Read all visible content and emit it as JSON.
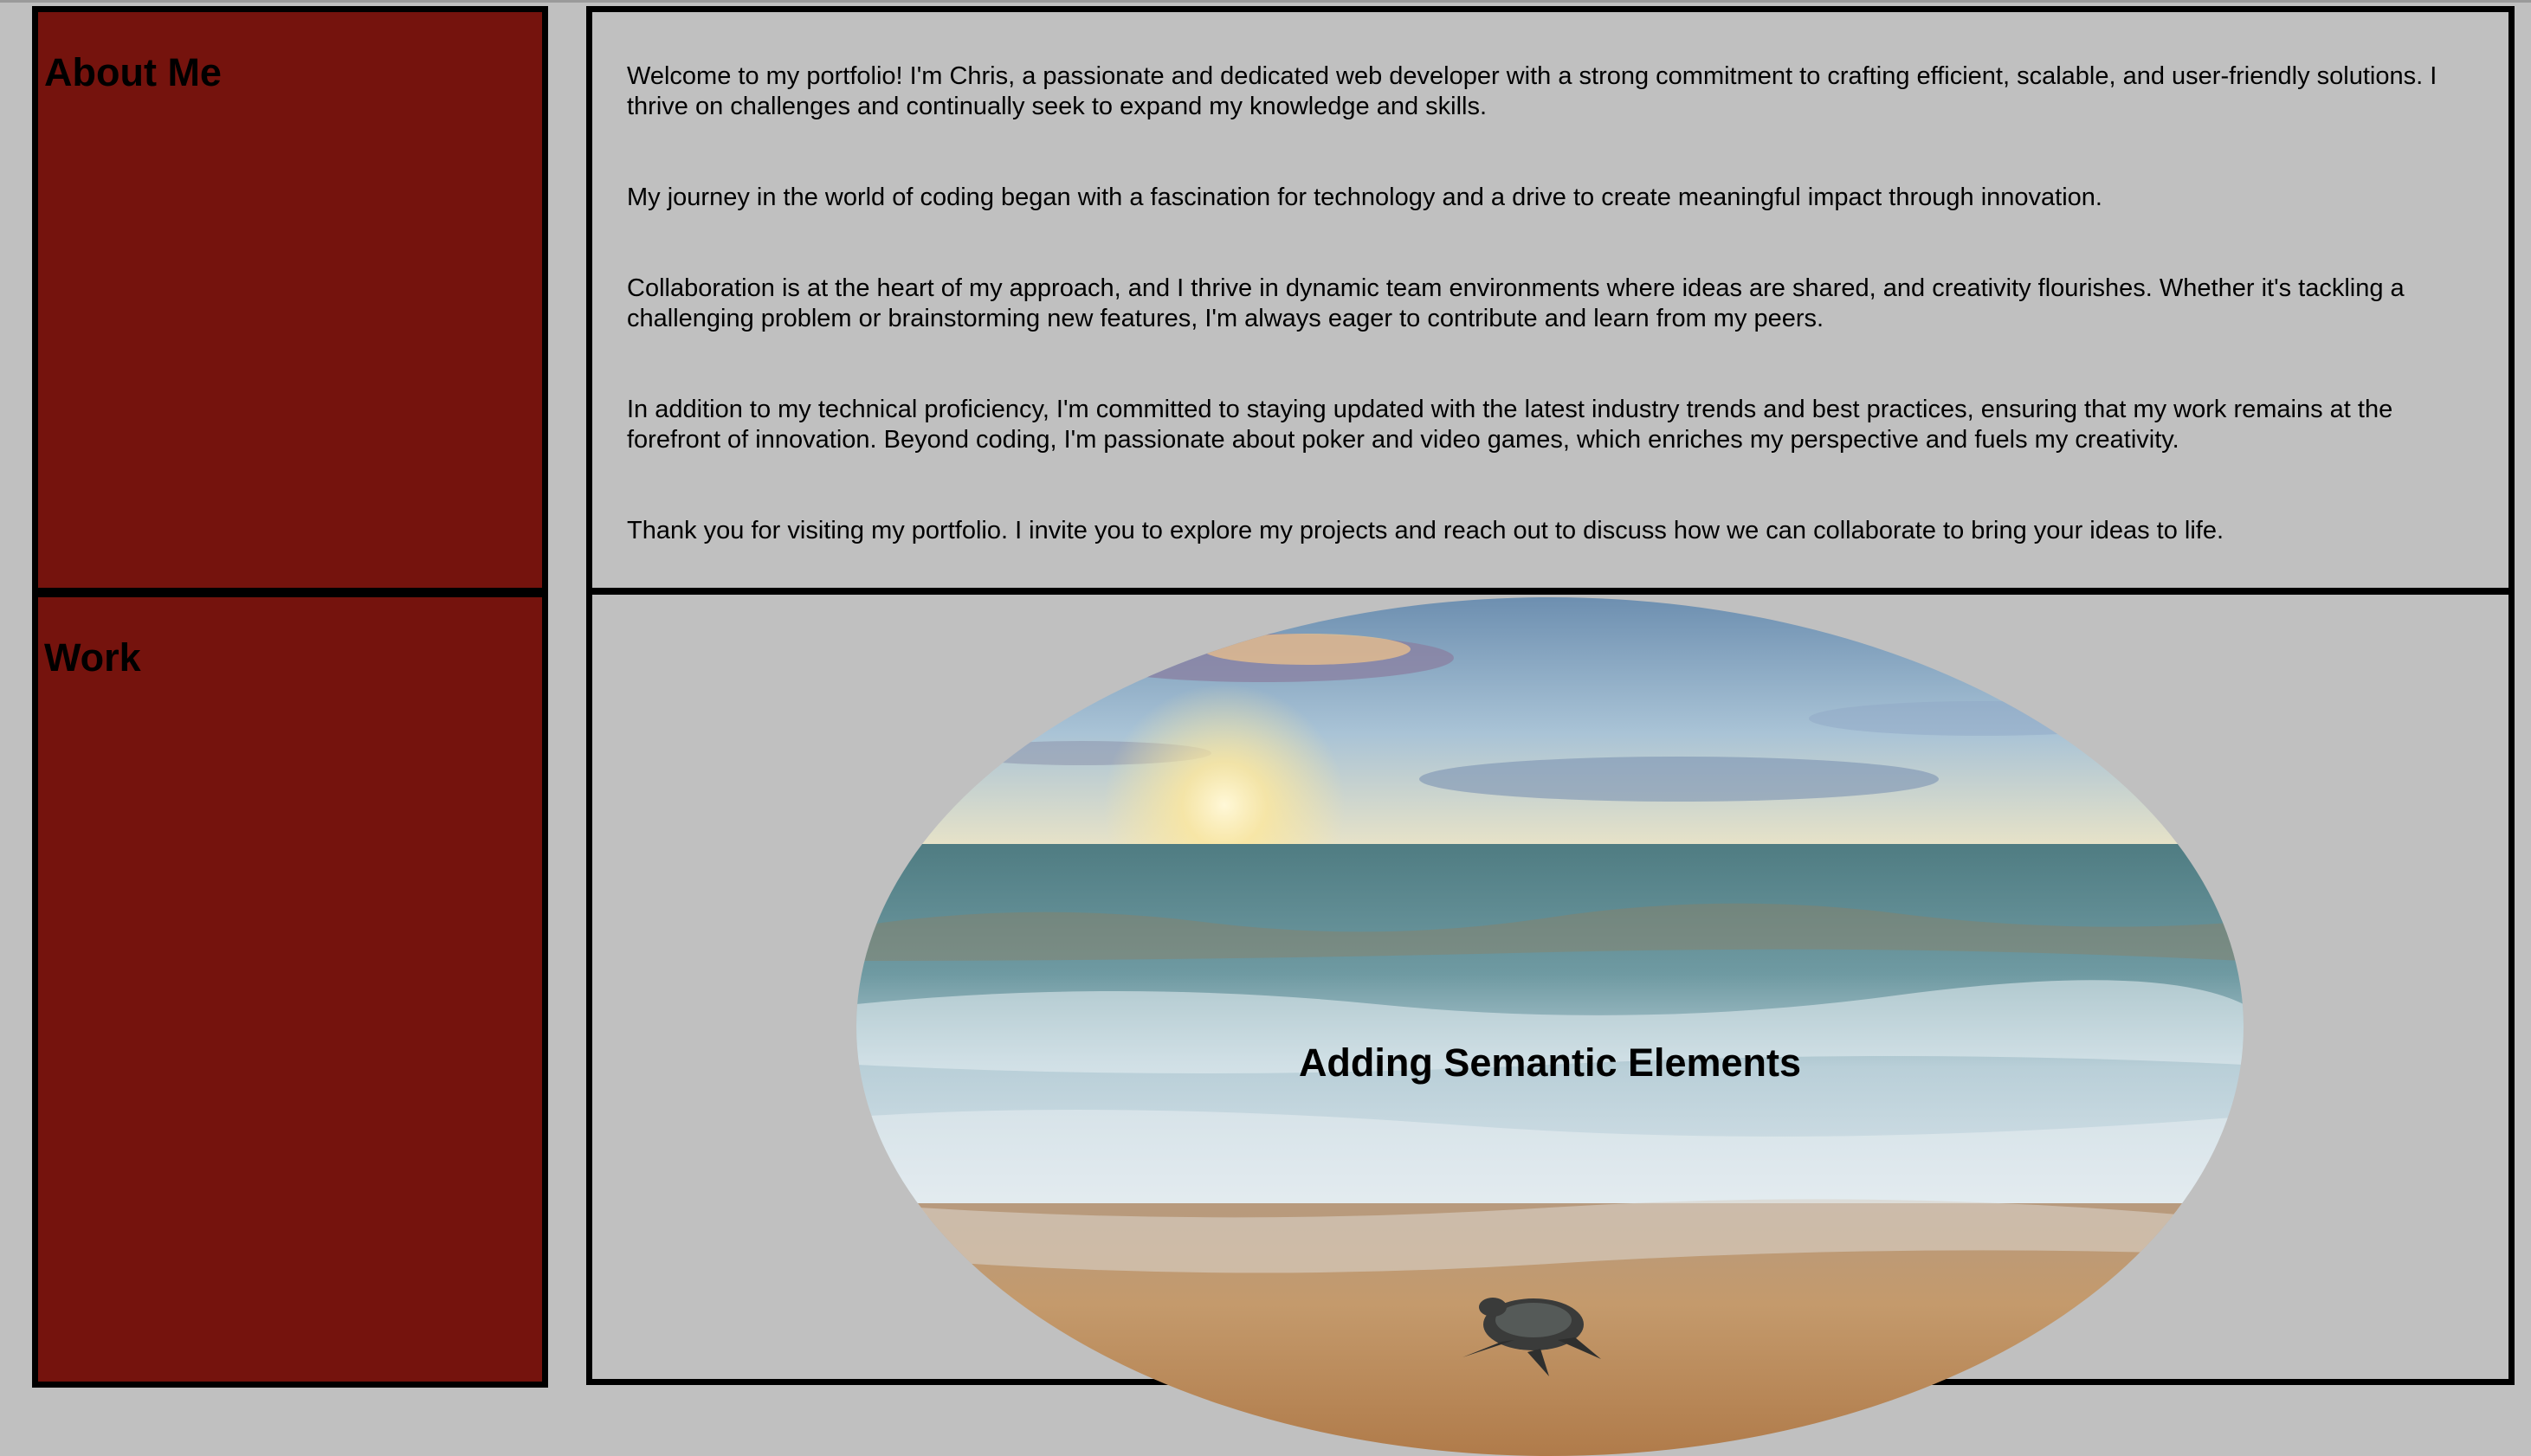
{
  "about": {
    "heading": "About Me",
    "paragraphs": [
      "Welcome to my portfolio! I'm Chris, a passionate and dedicated web developer with a strong commitment to crafting efficient, scalable, and user-friendly solutions. I thrive on challenges and continually seek to expand my knowledge and skills.",
      "My journey in the world of coding began with a fascination for technology and a drive to create meaningful impact through innovation.",
      "Collaboration is at the heart of my approach, and I thrive in dynamic team environments where ideas are shared, and creativity flourishes. Whether it's tackling a challenging problem or brainstorming new features, I'm always eager to contribute and learn from my peers.",
      "In addition to my technical proficiency, I'm committed to staying updated with the latest industry trends and best practices, ensuring that my work remains at the forefront of innovation. Beyond coding, I'm passionate about poker and video games, which enriches my perspective and fuels my creativity.",
      "Thank you for visiting my portfolio. I invite you to explore my projects and reach out to discuss how we can collaborate to bring your ideas to life."
    ]
  },
  "work": {
    "heading": "Work",
    "project_title": "Adding Semantic Elements"
  },
  "colors": {
    "page_background": "#c0c0c0",
    "sidebar_background": "#75130d",
    "border": "#000000"
  }
}
